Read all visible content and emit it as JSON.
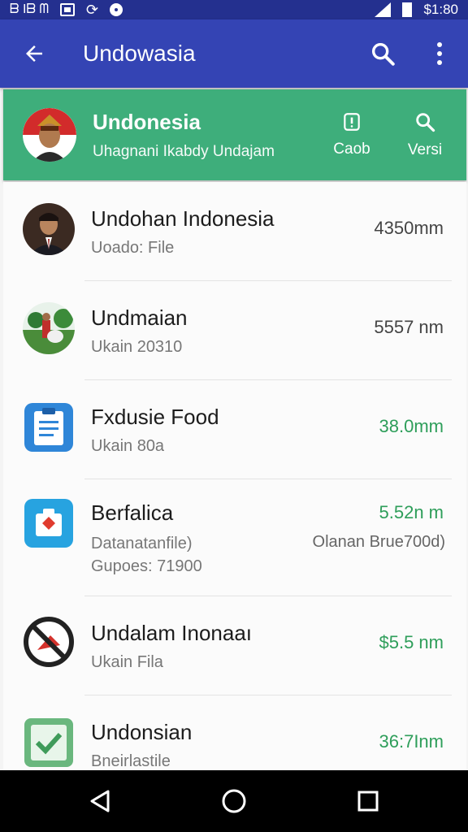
{
  "status_bar": {
    "left_text": "ᗷ Iᗷ ᗰ",
    "time": "$1:80"
  },
  "app_bar": {
    "title": "Undowasia",
    "back_icon": "arrow-left-icon",
    "search_icon": "search-icon",
    "more_icon": "more-vert-icon"
  },
  "header": {
    "title": "Undonesia",
    "subtitle": "Uhagnani Ikabdy Undajam",
    "actions": [
      {
        "label": "Caob",
        "icon": "info-icon"
      },
      {
        "label": "Versi",
        "icon": "search-icon"
      }
    ]
  },
  "list": [
    {
      "title": "Undohan Indonesia",
      "subtitle": "Uoado: File",
      "value": "4350mm",
      "value_color": "#444444",
      "icon": "person-avatar"
    },
    {
      "title": "Undmaian",
      "subtitle": "Ukain 20310",
      "value": "5557 nm",
      "value_color": "#444444",
      "icon": "photo-avatar"
    },
    {
      "title": "Fxdusie Food",
      "subtitle": "Ukain 80a",
      "value": "38.0mm",
      "value_color": "#2e9e5a",
      "icon": "clipboard-icon"
    },
    {
      "title": "Berfalica",
      "subtitle": "Datanatanfile)",
      "subtitle2": "Gupoes: 71900",
      "value": "5.52n m",
      "value_color": "#2e9e5a",
      "extra": "Olanan Brue700d)",
      "icon": "medical-bag-icon"
    },
    {
      "title": "Undalam Inonaaı",
      "subtitle": "Ukain Fila",
      "value": "$5.5 nm",
      "value_color": "#2e9e5a",
      "icon": "prohibited-icon"
    },
    {
      "title": "Undonsian",
      "subtitle": "Bneirlastile",
      "value": "36:7Inm",
      "value_color": "#2e9e5a",
      "icon": "check-tile-icon"
    }
  ],
  "nav_bar": {
    "back_icon": "nav-back-icon",
    "home_icon": "nav-home-icon",
    "recents_icon": "nav-recents-icon"
  }
}
